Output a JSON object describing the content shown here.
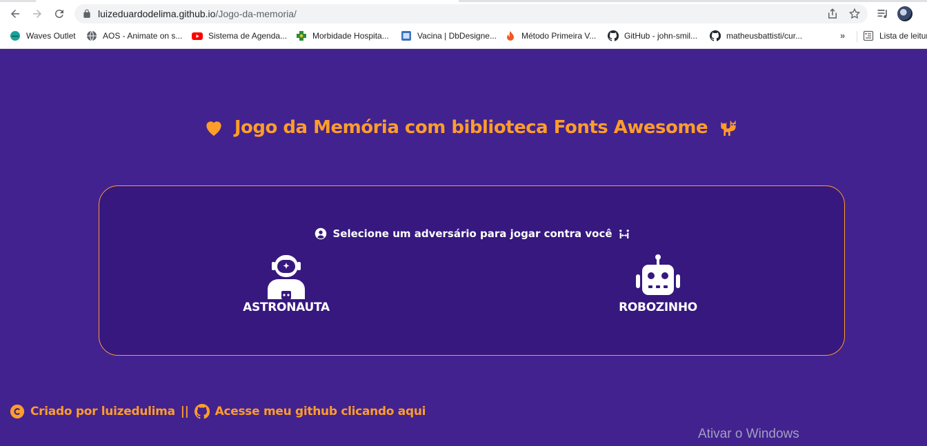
{
  "browser": {
    "url_host": "luizeduardodelima.github.io",
    "url_path": "/Jogo-da-memoria/",
    "bookmarks": [
      {
        "label": "Waves Outlet",
        "icon": "globe-teal-icon"
      },
      {
        "label": "AOS - Animate on s...",
        "icon": "globe-icon"
      },
      {
        "label": "Sistema de Agenda...",
        "icon": "youtube-icon"
      },
      {
        "label": "Morbidade Hospita...",
        "icon": "health-cross-icon"
      },
      {
        "label": "Vacina | DbDesigne...",
        "icon": "db-icon"
      },
      {
        "label": "Método Primeira V...",
        "icon": "flame-icon"
      },
      {
        "label": "GitHub - john-smil...",
        "icon": "github-icon"
      },
      {
        "label": "matheusbattisti/cur...",
        "icon": "github-icon"
      }
    ],
    "more_bookmarks": "»",
    "reading_list": "Lista de leitura"
  },
  "page": {
    "title": "Jogo da Memória com biblioteca Fonts Awesome",
    "panel_heading": "Selecione um adversário para jogar contra você",
    "opponents": [
      {
        "label": "ASTRONAUTA",
        "icon": "astronaut-icon"
      },
      {
        "label": "ROBOZINHO",
        "icon": "robot-icon"
      }
    ],
    "footer_credit": "Criado por luizedulima",
    "footer_separator": "||",
    "footer_link": "Acesse meu github clicando aqui"
  },
  "os": {
    "watermark": "Ativar o Windows"
  },
  "colors": {
    "background": "#42228f",
    "panel": "#36187f",
    "accent": "#ff9d2a",
    "text": "#ffffff"
  }
}
